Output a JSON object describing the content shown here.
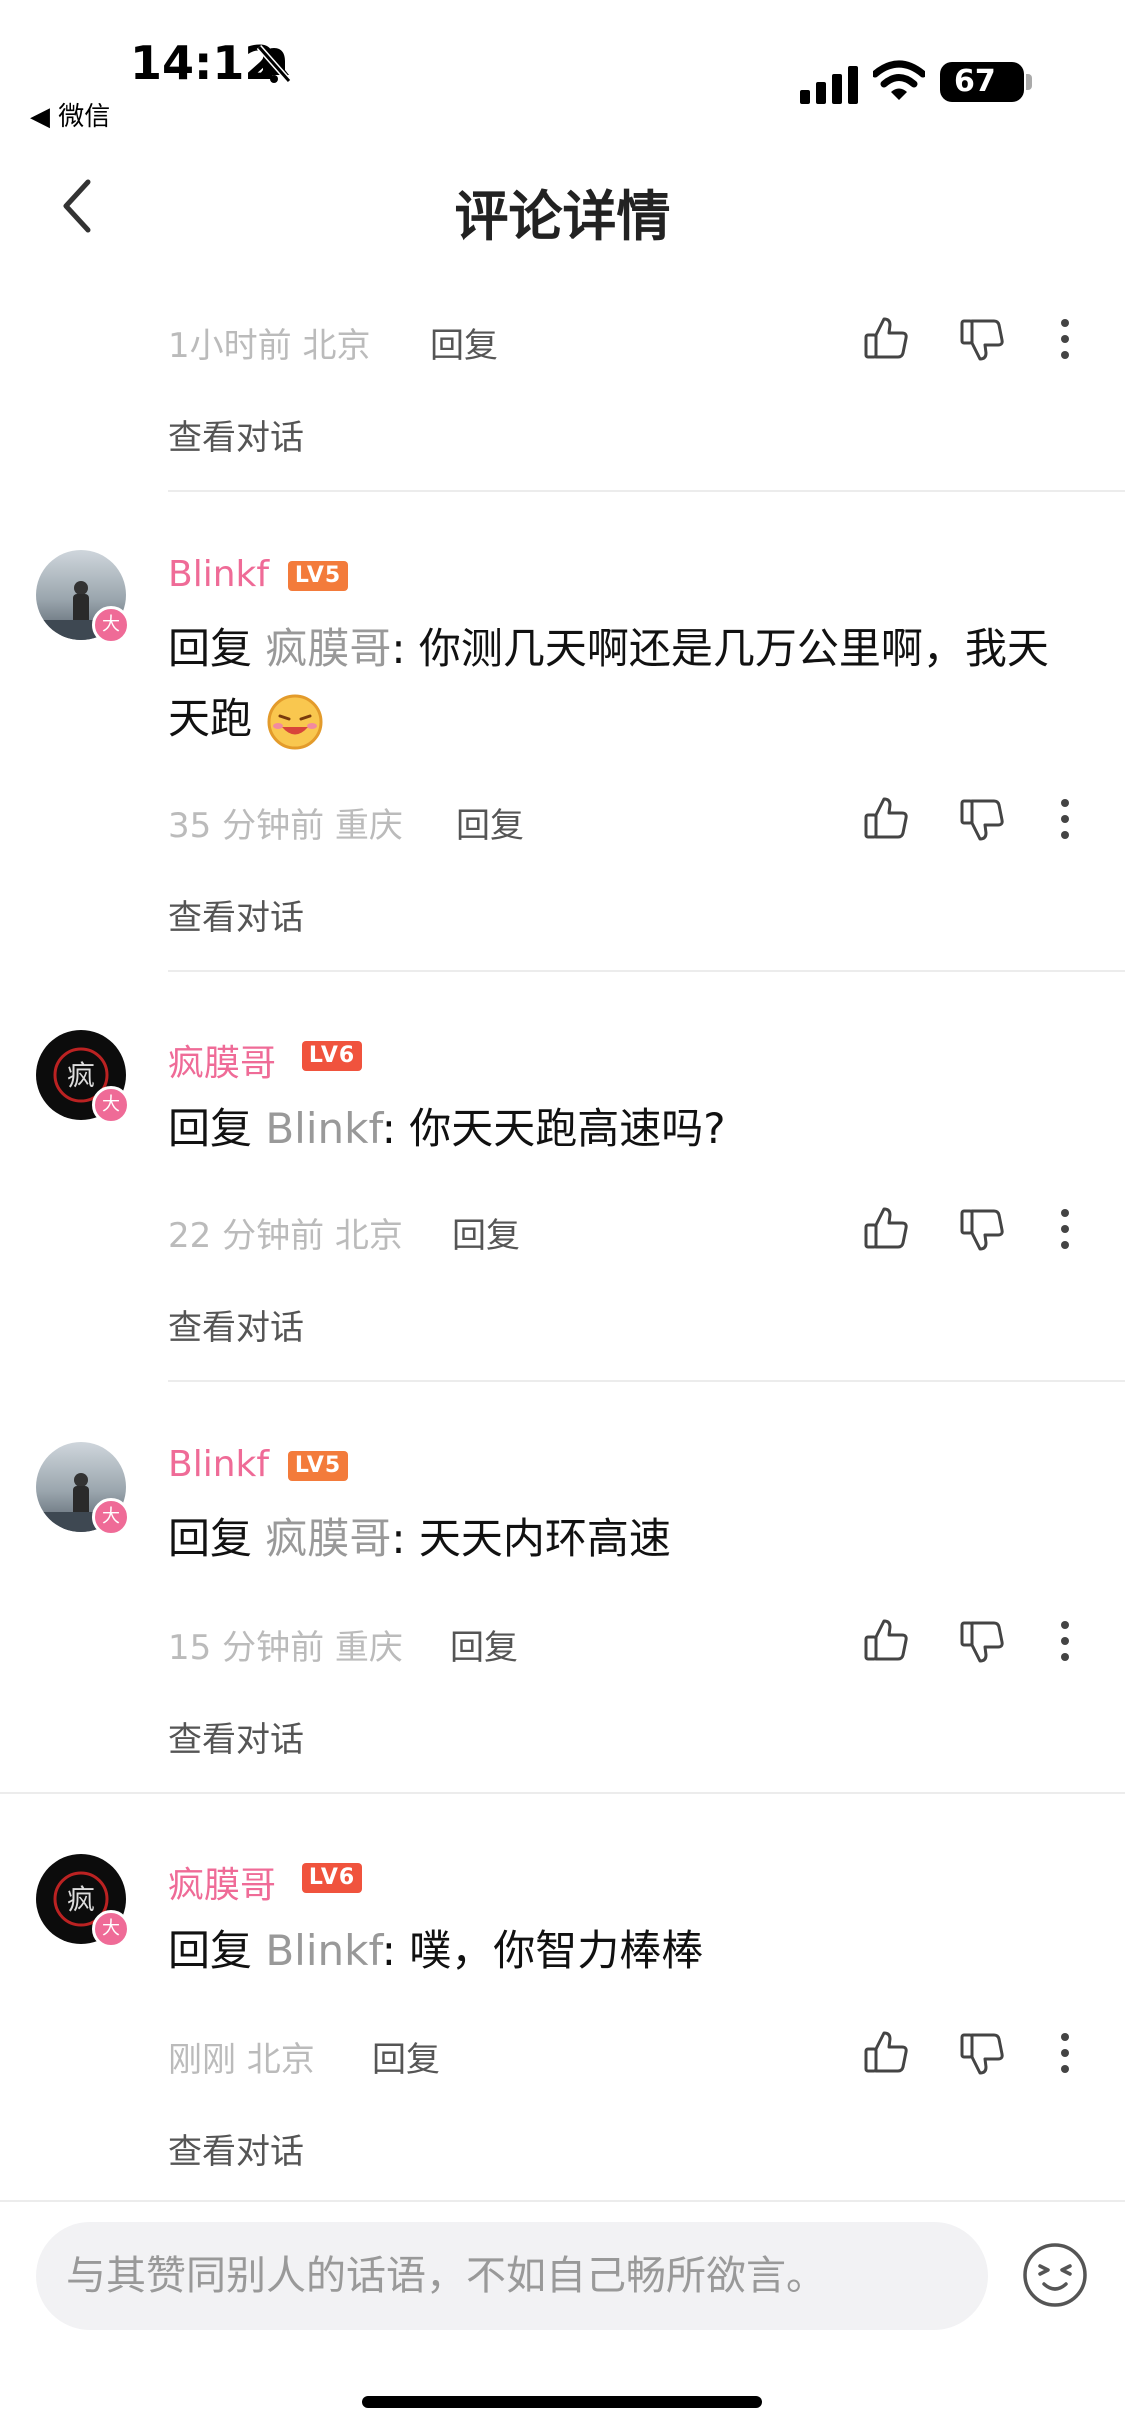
{
  "status_bar": {
    "back_app": "◀ 微信",
    "time": "14:12",
    "battery": "67"
  },
  "nav": {
    "title": "评论详情"
  },
  "comments": [
    {
      "meta": "1小时前 北京",
      "reply": "回复",
      "view": "查看对话"
    },
    {
      "user": "Blinkf",
      "level": "LV5",
      "prefix": "回复 ",
      "quoted": "疯膜哥",
      "text": ": 你测几天啊还是几万公里啊，我天天跑",
      "meta": "35 分钟前 重庆",
      "reply": "回复",
      "view": "查看对话",
      "badge": "大"
    },
    {
      "user": "疯膜哥",
      "level": "LV6",
      "prefix": "回复 ",
      "quoted": "Blinkf",
      "text": ": 你天天跑高速吗?",
      "meta": "22 分钟前 北京",
      "reply": "回复",
      "view": "查看对话",
      "badge": "大",
      "avatar_char": "疯"
    },
    {
      "user": "Blinkf",
      "level": "LV5",
      "prefix": "回复 ",
      "quoted": "疯膜哥",
      "text": ": 天天内环高速",
      "meta": "15 分钟前 重庆",
      "reply": "回复",
      "view": "查看对话",
      "badge": "大"
    },
    {
      "user": "疯膜哥",
      "level": "LV6",
      "prefix": "回复 ",
      "quoted": "Blinkf",
      "text": ": 噗，你智力棒棒",
      "meta": "刚刚 北京",
      "reply": "回复",
      "view": "查看对话",
      "badge": "大",
      "avatar_char": "疯"
    }
  ],
  "composer": {
    "placeholder": "与其赞同别人的话语，不如自己畅所欲言。"
  },
  "colors": {
    "name": "#ef6b97",
    "lv5": "#f37b3b",
    "lv6": "#f0533d"
  }
}
